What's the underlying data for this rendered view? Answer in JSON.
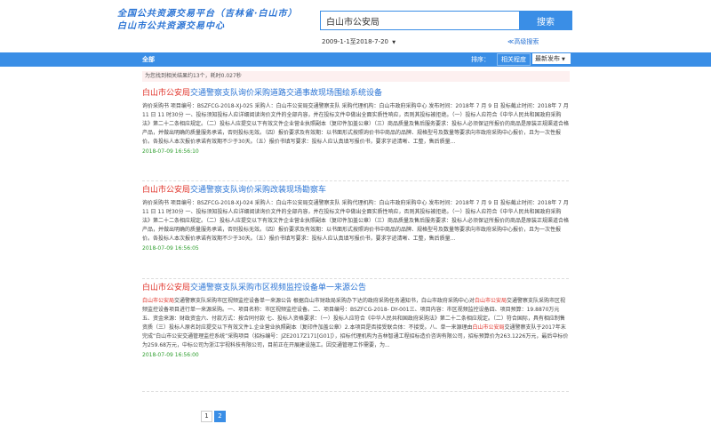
{
  "header": {
    "logo_line1": "全国公共资源交易平台（吉林省·白山市）",
    "logo_line2": "白山市公共资源交易中心",
    "search_value": "白山市公安局",
    "search_button": "搜索",
    "date_range": "2009-1-1至2018-7-20",
    "advanced_search": "≪高级搜索"
  },
  "navbar": {
    "all": "全部",
    "sort_label": "排序：",
    "sort_relevance": "相关程度",
    "sort_latest": "最新发布"
  },
  "stats": "为您找到相关结果约13个，耗时0.027秒",
  "results": [
    {
      "title_hl": "白山市公安局",
      "title_rest": "交通警察支队询价采购道路交通事故现场围绘系统设备",
      "body": "询价采购书    项目编号：BSZFCG-2018-XJ-025 采购人：白山市公安局交通警察支队 采购代理机构：白山市政府采购中心 发布时间：2018年 7 月 9 日    投标截止时间：2018年 7 月 11 日 11 时30分    一、投标须知投标人应详细阅读询价文件的全部内容，并在投标文件中做出全面实质性响应，否则其投标被拒绝。（一）投标人应符合《中华人民共和国政府采购法》第二十二条相应规定。（二）投标人应提交以下有效文件企业营业执照副本（复印件加盖公章）（三）商品质量及售后服务要求：投标人必须保证所报价的商品是原装正规渠道合格产品，并做出明确的质量服务承诺，否则投标无效。（四）报价要求及有效期：以书面形式按照询价书中商品的品牌、规格型号及数量等要求向市政府采购中心报价，且为一次性报价。各投标人本次报价承诺有效期不少于30天。（五）报价书填写要求：投标人应认真填写报价书，要求字迹清晰、工整，售后质量...",
      "date": "2018-07-09 16:56:10"
    },
    {
      "title_hl": "白山市公安局",
      "title_rest": "交通警察支队询价采购改装现场勘察车",
      "body": "询价采购书    项目编号：BSZFCG-2018-XJ-024 采购人：白山市公安局交通警察支队 采购代理机构：白山市政府采购中心 发布时间：2018年 7 月 9 日    投标截止时间：2018年 7 月 11 日 11 时30分    一、投标须知投标人应详细阅读询价文件的全部内容，并在投标文件中做出全面实质性响应，否则其投标被拒绝。（一）投标人应符合《中华人民共和国政府采购法》第二十二条相应规定。（二）投标人应提交以下有效文件企业营业执照副本（复印件加盖公章）（三）商品质量及售后服务要求：投标人必须保证所报价的商品是原装正规渠道合格产品，并做出明确的质量服务承诺，否则投标无效。（四）报价要求及有效期：以书面形式按照询价书中商品的品牌、规格型号及数量等要求向市政府采购中心报价，且为一次性报价。各投标人本次报价承诺有效期不少于30天。（五）报价书填写要求：投标人应认真填写报价书，要求字迹清晰、工整，售后质量...",
      "date": "2018-07-09 16:56:05"
    },
    {
      "title_hl": "白山市公安局",
      "title_rest": "交通警察支队采购市区视频监控设备单一来源公告",
      "body_parts": [
        "",
        "白山市公安局",
        "交通警察支队采购市区视频监控设备单一来源公告 根据白山市财政局采购办下达的政府采购任务通知书，白山市政府采购中心对",
        "白山市公安局",
        "交通警察支队采购市区视频监控设备项目进行单一来源采购。一、项目名称：市区视频监控设备。二、项目编号：BSZFCG-2018- DY-001三、项目内容：市区视频监控设备四、项目预算：19.8870万元五、资金来源：财政资金六、付款方式：按合同付款   七、投标人资格要求：（一）投标人应符合《中华人民共和国政府采购法》第二十二条相应规定。（二）符合国际，具有相应制售资质（三）投标人原名封应提交以下有效文件1.企业营业执照副本（复印件加盖公章）2.本项目是否接受联合体：不接受。八、单一来源理由",
        "白山市公安局",
        "交通警察支队于2017年末完成“白山市公安交通管理监控系统”采购项目（招标编号：JZE2017Z171[G01]），招标代理机构为吉林智通工程招标造价咨询有限公司，招标预算价为263.1226万元，最后中标价为259.68万元，中标公司为浙江宇视科技有限公司，目前正在开展建设施工。因交通管理工作需要，为..."
      ],
      "date": "2018-07-09 16:56:00"
    }
  ],
  "pager": [
    "1",
    "2"
  ],
  "colors": {
    "accent": "#3a8ee6",
    "highlight": "#e0332a",
    "date": "#2e9e2e"
  }
}
